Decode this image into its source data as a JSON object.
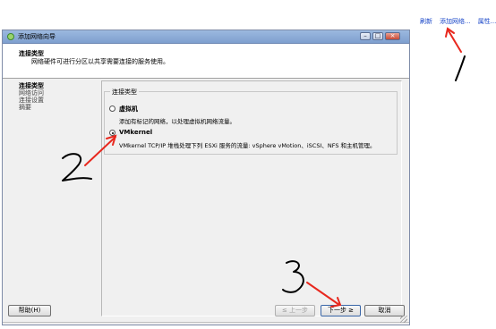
{
  "toplinks": [
    "刷新",
    "添加网络...",
    "属性..."
  ],
  "window": {
    "title": "添加网络向导"
  },
  "header": {
    "title": "连接类型",
    "description": "网络硬件可进行分区以共享需要连接的服务使用。"
  },
  "nav": [
    "连接类型",
    "网络访问",
    "连接设置",
    "摘要"
  ],
  "group": {
    "label": "连接类型",
    "options": [
      {
        "title": "虚拟机",
        "desc": "添加有标记的网络，以处理虚拟机网络流量。",
        "checked": false
      },
      {
        "title": "VMkernel",
        "desc": "VMkernel TCP/IP 堆栈处理下列 ESXi 服务的流量: vSphere vMotion、iSCSI、NFS 和主机管理。",
        "checked": true
      }
    ]
  },
  "buttons": {
    "help": "帮助(H)",
    "back": "≤ 上一步",
    "next": "下一步 ≥",
    "cancel": "取消"
  },
  "annotations": [
    "1",
    "2",
    "3"
  ],
  "colors": {
    "annotation": "#e8281e",
    "link": "#1a47c8"
  }
}
